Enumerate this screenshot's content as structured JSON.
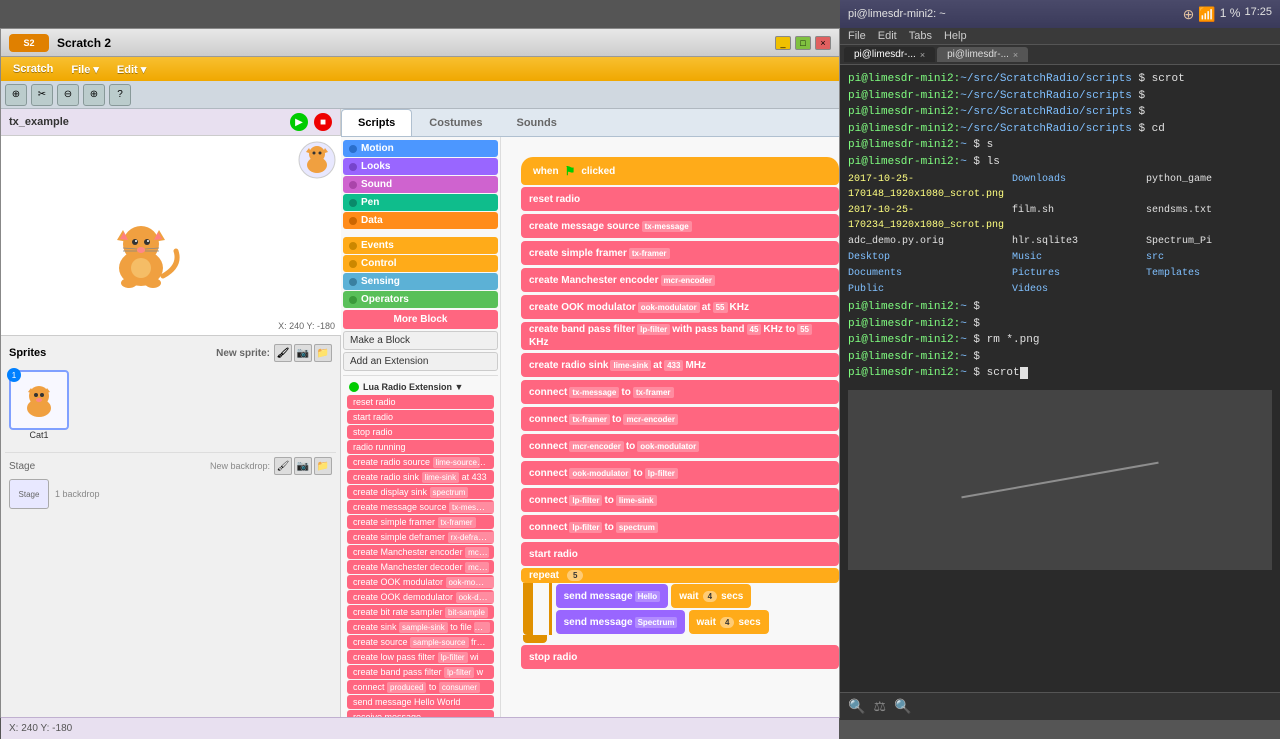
{
  "scratch_window": {
    "title": "Scratch 2",
    "menus": [
      "Scratch",
      "File",
      "Edit"
    ],
    "toolbar_tools": [
      "copy",
      "cut",
      "shrink",
      "grow",
      "help"
    ],
    "tabs": [
      "Scripts",
      "Costumes",
      "Sounds"
    ],
    "active_tab": "Scripts",
    "sprite_name": "tx_example",
    "coord": "X: 240  Y: -180",
    "categories": [
      {
        "name": "Motion",
        "color": "#4c97ff"
      },
      {
        "name": "Looks",
        "color": "#9966ff"
      },
      {
        "name": "Sound",
        "color": "#cf63cf"
      },
      {
        "name": "Pen",
        "color": "#0fbd8c"
      },
      {
        "name": "Data",
        "color": "#ff8c1a"
      },
      {
        "name": "Events",
        "color": "#ffab19"
      },
      {
        "name": "Control",
        "color": "#ffab19"
      },
      {
        "name": "Sensing",
        "color": "#5cb1d6"
      },
      {
        "name": "Operators",
        "color": "#59c059"
      }
    ],
    "more_blocks": "More Block",
    "make_block": "Make a Block",
    "add_extension": "Add an Extension",
    "lua_extension": {
      "name": "Lua Radio Extension",
      "arrow": "▼",
      "dot_color": "#00cc00",
      "blocks": [
        "reset radio",
        "start radio",
        "stop radio",
        "radio running",
        "create radio source lime-source at",
        "create radio sink lime-sink at 433",
        "create display sink spectrum",
        "create message source tx-message",
        "create simple framer tx-framer",
        "create simple deframer rx-deframer",
        "create Manchester encoder mcr-encoder",
        "create Manchester decoder mcrd",
        "create OOK modulator ook-modulator",
        "create OOK demodulator ook-demo",
        "create bit rate sampler bit-sample",
        "create sink sample-sink to file file",
        "create source sample-source from",
        "create low pass filter lp-filter wi",
        "create band pass filter lp-filter w",
        "connect produced to consumer",
        "send message Hello World",
        "receive message"
      ]
    },
    "script_blocks": [
      {
        "type": "hat",
        "text": "when  clicked"
      },
      {
        "type": "pink",
        "text": "reset radio"
      },
      {
        "type": "pink",
        "text": "create message source tx-message"
      },
      {
        "type": "pink",
        "text": "create simple framer tx-framer"
      },
      {
        "type": "pink",
        "text": "create Manchester encoder mcr-encoder"
      },
      {
        "type": "pink",
        "text": "create OOK modulator ook-modulator at 55 KHz"
      },
      {
        "type": "pink",
        "text": "create band pass filter lp-filter with pass band 45 KHz to 55 KHz"
      },
      {
        "type": "pink",
        "text": "create radio sink lime-sink at 433 MHz"
      },
      {
        "type": "pink",
        "text": "connect tx-message to tx-framer"
      },
      {
        "type": "pink",
        "text": "connect tx-framer to mcr-encoder"
      },
      {
        "type": "pink",
        "text": "connect mcr-encoder to ook-modulator"
      },
      {
        "type": "pink",
        "text": "connect ook-modulator to lp-filter"
      },
      {
        "type": "pink",
        "text": "connect lp-filter to lime-sink"
      },
      {
        "type": "pink",
        "text": "connect lp-filter to spectrum"
      },
      {
        "type": "pink",
        "text": "start radio"
      },
      {
        "type": "repeat",
        "count": "5",
        "children": [
          {
            "type": "purple",
            "text": "send message Hello"
          },
          {
            "type": "orange",
            "text": "wait 4 secs"
          },
          {
            "type": "purple",
            "text": "send message Spectrum"
          },
          {
            "type": "orange",
            "text": "wait 4 secs"
          }
        ]
      },
      {
        "type": "pink",
        "text": "stop radio"
      }
    ],
    "sprites": {
      "label": "Sprites",
      "new_sprite_label": "New sprite:",
      "items": [
        {
          "name": "Cat1",
          "num": "1"
        }
      ],
      "stage_label": "Stage",
      "backdrop_label": "1 backdrop",
      "new_backdrop_label": "New backdrop:"
    }
  },
  "terminal_window": {
    "title": "pi@limesdr-mini2: ~",
    "tabs": [
      {
        "label": "pi@limesdr-...",
        "active": true
      },
      {
        "label": "pi@limesdr-...",
        "active": false
      }
    ],
    "menus": [
      "File",
      "Edit",
      "Tabs",
      "Help"
    ],
    "lines": [
      {
        "prompt": "pi@limesdr-mini2:~/src/ScratchRadio/scripts",
        "cmd": "$ scrot"
      },
      {
        "prompt": "pi@limesdr-mini2:~/src/ScratchRadio/scripts",
        "cmd": "$"
      },
      {
        "prompt": "pi@limesdr-mini2:~/src/ScratchRadio/scripts",
        "cmd": "$"
      },
      {
        "prompt": "pi@limesdr-mini2:~/src/ScratchRadio/scripts",
        "cmd": "$ cd"
      },
      {
        "prompt": "pi@limesdr-mini2:~",
        "cmd": "$ s"
      },
      {
        "prompt": "pi@limesdr-mini2:~",
        "cmd": "$ ls"
      },
      {
        "files": [
          "2017-10-25-170148_1920x1080_scrot.png",
          "Downloads",
          "python_game",
          "2017-10-25-170234_1920x1080_scrot.png",
          "film.sh",
          "sendsms.txt",
          "adc_demo.py.orig",
          "hlr.sqlite3",
          "Spectrum_Pi",
          "Desktop",
          "Music",
          "src",
          "Documents",
          "Pictures",
          "Templates",
          "Public",
          "Videos"
        ]
      },
      {
        "prompt": "pi@limesdr-mini2:~",
        "cmd": "$"
      },
      {
        "prompt": "pi@limesdr-mini2:~",
        "cmd": "$"
      },
      {
        "prompt": "pi@limesdr-mini2:~",
        "cmd": "$ rm *.png"
      },
      {
        "prompt": "pi@limesdr-mini2:~",
        "cmd": "$"
      },
      {
        "prompt": "pi@limesdr-mini2:~",
        "cmd": "$ scrot",
        "cursor": true
      }
    ],
    "footer_icons": [
      "🔍",
      "⚖",
      "🔍"
    ],
    "time": "17:25",
    "battery": "1 %"
  }
}
